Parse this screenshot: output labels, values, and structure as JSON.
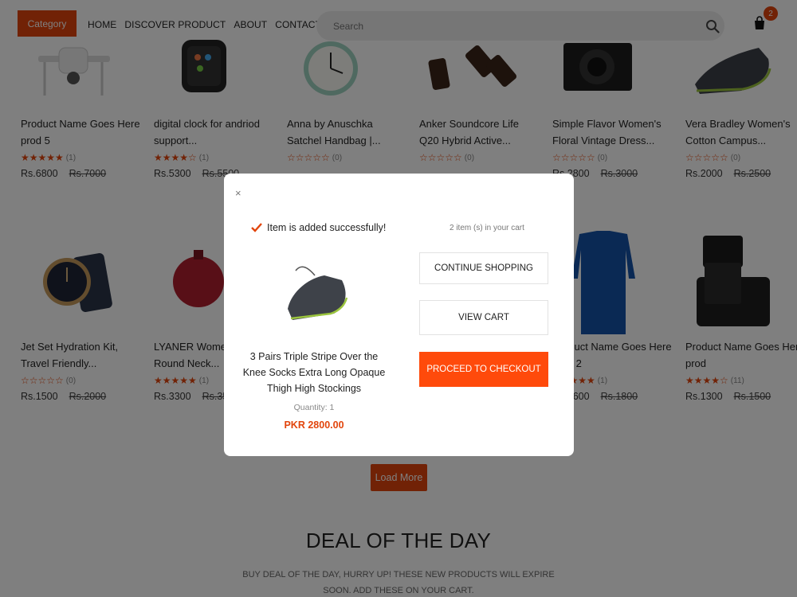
{
  "header": {
    "category_label": "Category",
    "nav": [
      "HOME",
      "DISCOVER PRODUCT",
      "ABOUT",
      "CONTACT"
    ],
    "search_placeholder": "Search",
    "cart_count": "2"
  },
  "products": [
    {
      "name": "Product Name Goes Here prod 5",
      "stars": "★★★★★",
      "reviews": "(1)",
      "price": "Rs.6800",
      "old_price": "Rs.7000",
      "image": "drone"
    },
    {
      "name": "digital clock for andriod support...",
      "stars": "★★★★☆",
      "reviews": "(1)",
      "price": "Rs.5300",
      "old_price": "Rs.5500",
      "image": "smartwatch"
    },
    {
      "name": "Anna by Anuschka Satchel Handbag |...",
      "stars": "☆☆☆☆☆",
      "reviews": "(0)",
      "price": "",
      "old_price": "",
      "image": "clock"
    },
    {
      "name": "Anker Soundcore Life Q20 Hybrid Active...",
      "stars": "☆☆☆☆☆",
      "reviews": "(0)",
      "price": "",
      "old_price": "",
      "image": "headphones"
    },
    {
      "name": "Simple Flavor Women's Floral Vintage Dress...",
      "stars": "☆☆☆☆☆",
      "reviews": "(0)",
      "price": "Rs.2800",
      "old_price": "Rs.3000",
      "image": "camera"
    },
    {
      "name": "Vera Bradley Women's Cotton Campus...",
      "stars": "☆☆☆☆☆",
      "reviews": "(0)",
      "price": "Rs.2000",
      "old_price": "Rs.2500",
      "image": "shoe"
    },
    {
      "name": "Jet Set Hydration Kit, Travel Friendly...",
      "stars": "☆☆☆☆☆",
      "reviews": "(0)",
      "price": "Rs.1500",
      "old_price": "Rs.2000",
      "image": "watch"
    },
    {
      "name": "LYANER Women's Tunic Round Neck...",
      "stars": "★★★★★",
      "reviews": "(1)",
      "price": "Rs.3300",
      "old_price": "Rs.3500",
      "image": "pomegranate"
    },
    {
      "name": "",
      "stars": "",
      "reviews": "",
      "price": "",
      "old_price": "",
      "image": "none"
    },
    {
      "name": "",
      "stars": "",
      "reviews": "",
      "price": "",
      "old_price": "",
      "image": "none"
    },
    {
      "name": "Product Name Goes Here prod 2",
      "stars": "★★★★★",
      "reviews": "(1)",
      "price": "Rs.1600",
      "old_price": "Rs.1800",
      "image": "sweater"
    },
    {
      "name": "Product Name Goes Here prod",
      "stars": "★★★★☆",
      "reviews": "(11)",
      "price": "Rs.1300",
      "old_price": "Rs.1500",
      "image": "dslr"
    }
  ],
  "load_more_label": "Load More",
  "deal": {
    "title": "DEAL OF THE DAY",
    "subtitle": "BUY DEAL OF THE DAY, HURRY UP! THESE NEW PRODUCTS WILL EXPIRE SOON. ADD THESE ON YOUR CART."
  },
  "modal": {
    "close_symbol": "×",
    "success_text": "Item is added successfully!",
    "cart_items_text": "2 item (s) in your cart",
    "product_name": "3 Pairs Triple Stripe Over the Knee Socks Extra Long Opaque Thigh High Stockings",
    "quantity": "Quantity: 1",
    "price": "PKR 2800.00",
    "continue_label": "CONTINUE SHOPPING",
    "view_cart_label": "VIEW CART",
    "checkout_label": "PROCEED TO CHECKOUT"
  },
  "colors": {
    "accent": "#e2450c",
    "checkout": "#ff4a0b"
  }
}
